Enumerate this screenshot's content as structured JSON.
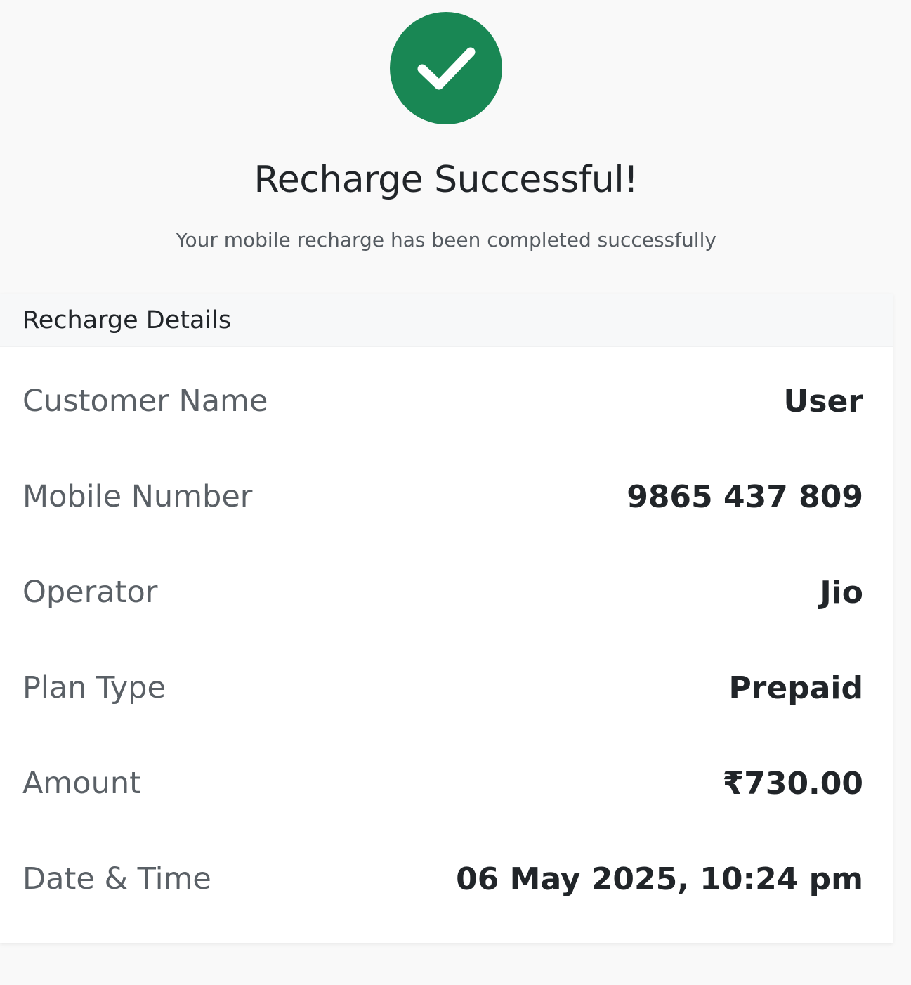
{
  "status": {
    "icon": "check-circle-icon",
    "color": "#198754",
    "title": "Recharge Successful!",
    "subtitle": "Your mobile recharge has been completed successfully"
  },
  "details": {
    "header": "Recharge Details",
    "rows": [
      {
        "label": "Customer Name",
        "value": "User"
      },
      {
        "label": "Mobile Number",
        "value": "9865 437 809"
      },
      {
        "label": "Operator",
        "value": "Jio"
      },
      {
        "label": "Plan Type",
        "value": "Prepaid"
      },
      {
        "label": "Amount",
        "value": "₹730.00"
      },
      {
        "label": "Date & Time",
        "value": "06 May 2025, 10:24 pm"
      }
    ]
  }
}
